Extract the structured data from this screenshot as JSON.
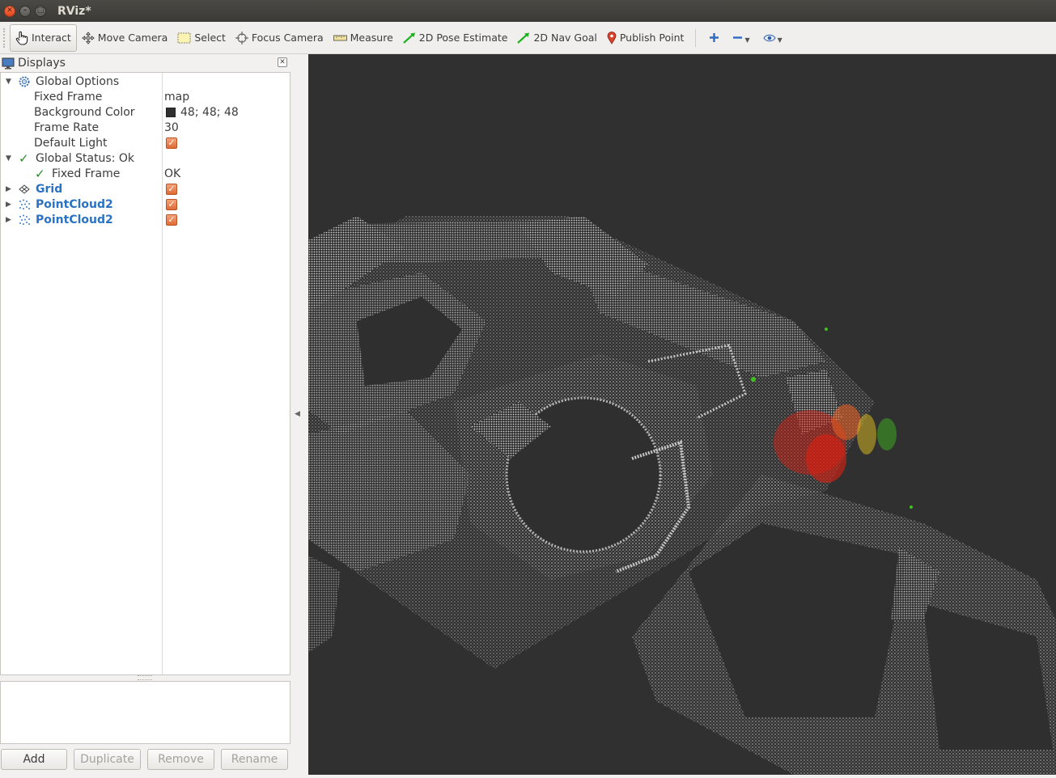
{
  "window": {
    "title": "RViz*"
  },
  "toolbar": {
    "tools": [
      {
        "label": "Interact",
        "icon": "hand-pointer-icon",
        "active": true
      },
      {
        "label": "Move Camera",
        "icon": "move-camera-icon",
        "active": false
      },
      {
        "label": "Select",
        "icon": "select-box-icon",
        "active": false
      },
      {
        "label": "Focus Camera",
        "icon": "focus-crosshair-icon",
        "active": false
      },
      {
        "label": "Measure",
        "icon": "ruler-icon",
        "active": false
      },
      {
        "label": "2D Pose Estimate",
        "icon": "green-arrow-icon",
        "active": false
      },
      {
        "label": "2D Nav Goal",
        "icon": "green-arrow-icon",
        "active": false
      },
      {
        "label": "Publish Point",
        "icon": "map-pin-icon",
        "active": false
      }
    ],
    "extra_icons": [
      "add-tool-icon",
      "remove-tool-icon",
      "view-eye-icon"
    ]
  },
  "displays_panel": {
    "title": "Displays",
    "rows": [
      {
        "label": "Global Options",
        "value": "",
        "expanded": true,
        "icon": "gear-icon"
      },
      {
        "label": "Fixed Frame",
        "value": "map"
      },
      {
        "label": "Background Color",
        "value": "48; 48; 48",
        "swatch": "#303030"
      },
      {
        "label": "Frame Rate",
        "value": "30"
      },
      {
        "label": "Default Light",
        "value": "",
        "checked": true
      },
      {
        "label": "Global Status: Ok",
        "value": "",
        "expanded": true,
        "icon": "check-icon"
      },
      {
        "label": "Fixed Frame",
        "value": "OK",
        "icon": "check-icon"
      },
      {
        "label": "Grid",
        "value": "",
        "checked": true,
        "icon": "grid-icon"
      },
      {
        "label": "PointCloud2",
        "value": "",
        "checked": true,
        "icon": "pointcloud-icon"
      },
      {
        "label": "PointCloud2",
        "value": "",
        "checked": true,
        "icon": "pointcloud-icon"
      }
    ],
    "buttons": {
      "add": "Add",
      "duplicate": "Duplicate",
      "remove": "Remove",
      "rename": "Rename"
    }
  },
  "viewport": {
    "background_color": "#303030",
    "cloud_color": "#c8c8c8",
    "highlight_colors": [
      "#e02010",
      "#f06020",
      "#e0c020",
      "#40c020"
    ]
  }
}
